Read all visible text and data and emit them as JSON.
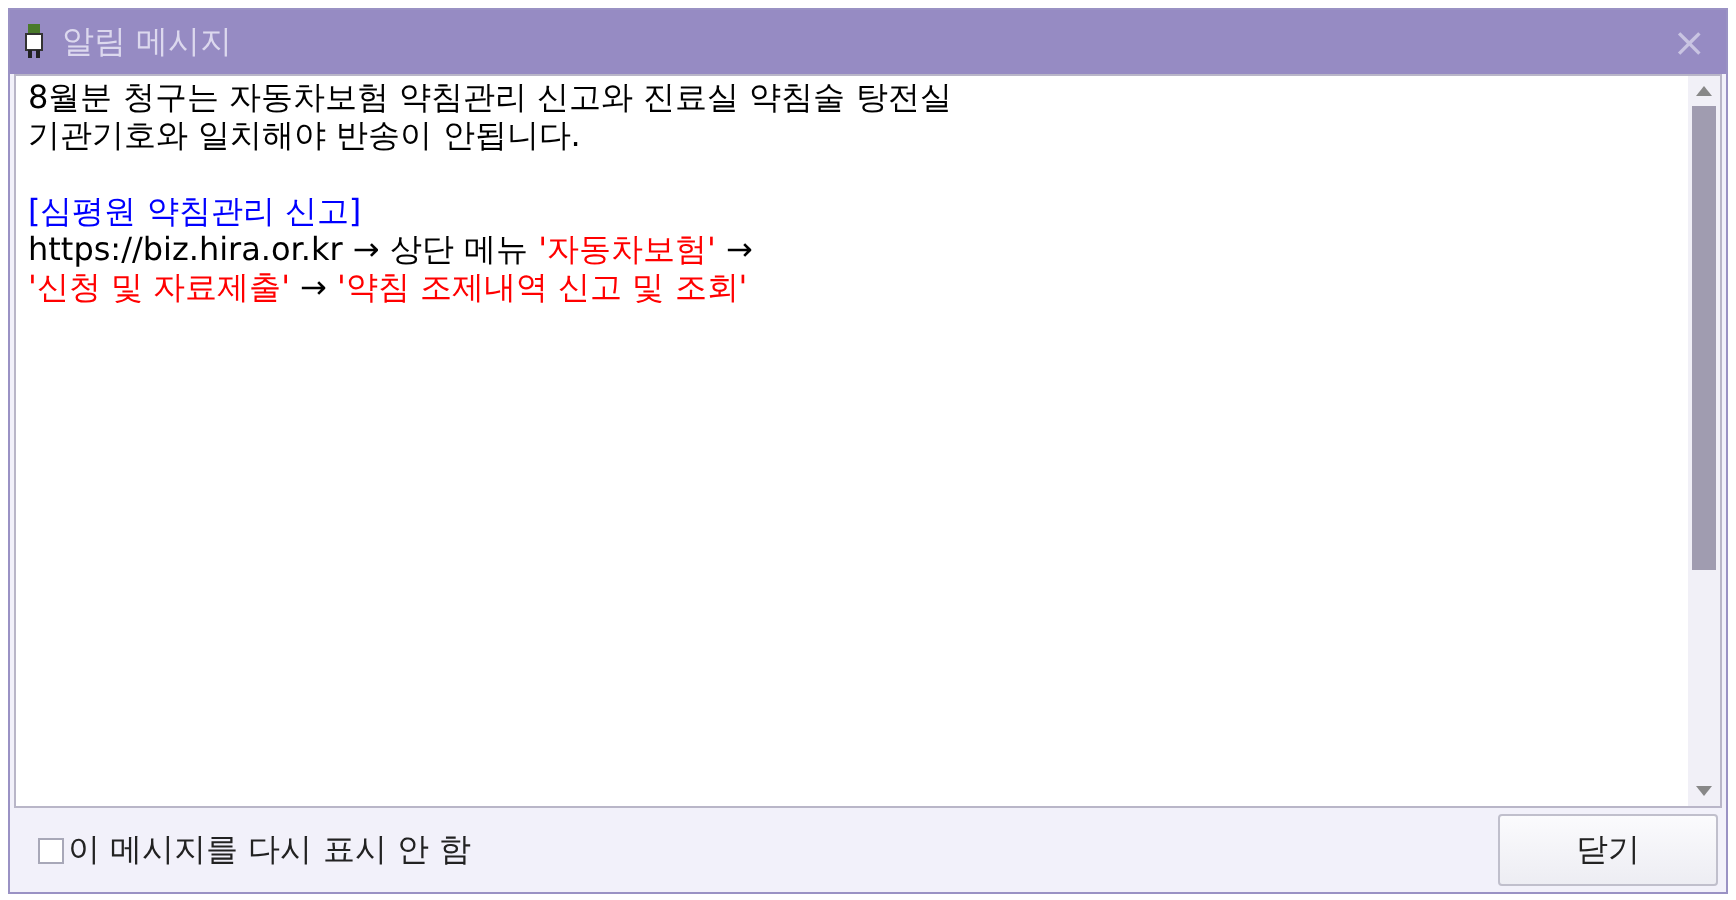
{
  "window": {
    "title": "알림 메시지",
    "close": "×"
  },
  "message": {
    "paragraphs": [
      [
        [
          {
            "text": "8월분 청구는 자동차보험 약침관리 신고와 진료실 약침술 탕전실",
            "color": "#000000"
          }
        ],
        [
          {
            "text": "기관기호와 일치해야 반송이 안됩니다.",
            "color": "#000000"
          }
        ]
      ],
      [
        [
          {
            "text": "[심평원 약침관리 신고]",
            "color": "#0000ff"
          }
        ],
        [
          {
            "text": "https://biz.hira.or.kr → 상단 메뉴 ",
            "color": "#000000"
          },
          {
            "text": "'자동차보험'",
            "color": "#ff0000"
          },
          {
            "text": " →",
            "color": "#000000"
          }
        ],
        [
          {
            "text": "'신청 및 자료제출'",
            "color": "#ff0000"
          },
          {
            "text": " → ",
            "color": "#000000"
          },
          {
            "text": "'약침 조제내역 신고 및 조회'",
            "color": "#ff0000"
          }
        ]
      ]
    ]
  },
  "footer": {
    "checkbox": {
      "label": "이 메시지를 다시 표시 안 함",
      "checked": false
    },
    "close_button": "닫기"
  }
}
